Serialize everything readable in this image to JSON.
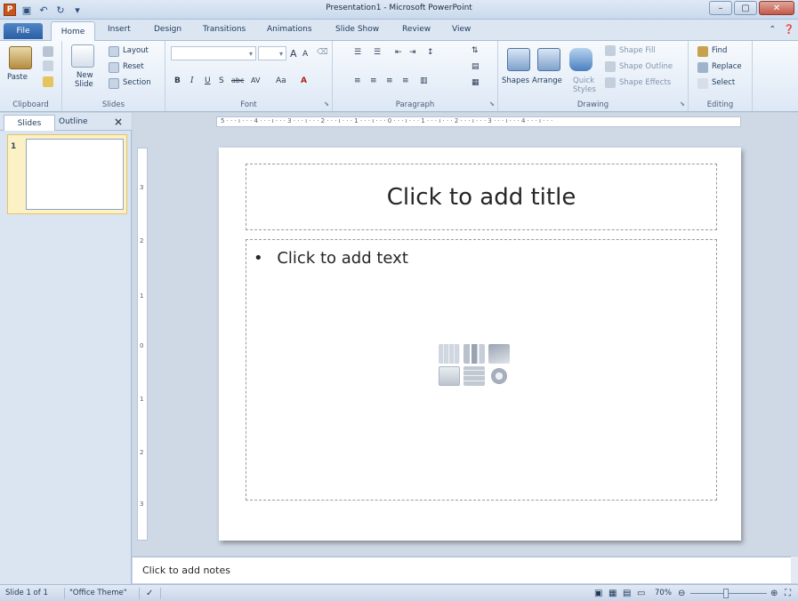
{
  "window": {
    "title": "Presentation1 - Microsoft PowerPoint",
    "app_icon_letter": "P"
  },
  "tabs": {
    "file": "File",
    "home": "Home",
    "insert": "Insert",
    "design": "Design",
    "transitions": "Transitions",
    "animations": "Animations",
    "slideshow": "Slide Show",
    "review": "Review",
    "view": "View"
  },
  "ribbon": {
    "clipboard": {
      "paste": "Paste",
      "label": "Clipboard"
    },
    "slides": {
      "new_slide_1": "New",
      "new_slide_2": "Slide",
      "layout": "Layout",
      "reset": "Reset",
      "section": "Section",
      "label": "Slides"
    },
    "font": {
      "label": "Font",
      "bold": "B",
      "italic": "I",
      "underline": "U",
      "shadow": "S",
      "strike": "abc",
      "spacing": "AV",
      "case": "Aa",
      "grow": "A",
      "shrink": "A"
    },
    "paragraph": {
      "label": "Paragraph"
    },
    "drawing": {
      "shapes": "Shapes",
      "arrange": "Arrange",
      "quick_styles_1": "Quick",
      "quick_styles_2": "Styles",
      "shape_fill": "Shape Fill",
      "shape_outline": "Shape Outline",
      "shape_effects": "Shape Effects",
      "label": "Drawing"
    },
    "editing": {
      "find": "Find",
      "replace": "Replace",
      "select": "Select",
      "label": "Editing"
    }
  },
  "left_pane": {
    "tab_slides": "Slides",
    "tab_outline": "Outline",
    "close": "×",
    "slide_number": "1"
  },
  "slide": {
    "title_placeholder": "Click to add title",
    "body_placeholder": "Click to add text",
    "bullet": "•"
  },
  "rulers": {
    "horizontal": "5 · · · ı · · · 4 · · · ı · · · 3 · · · ı · · · 2 · · · ı · · · 1 · · · ı · · · 0 · · · ı · · · 1 · · · ı · · · 2 · · · ı · · · 3 · · · ı · · · 4 · · · ı · · ·",
    "vertical_ticks": [
      "3",
      "2",
      "1",
      "0",
      "1",
      "2",
      "3"
    ]
  },
  "notes": {
    "placeholder": "Click to add notes"
  },
  "status": {
    "slide_position": "Slide 1 of 1",
    "theme": "\"Office Theme\"",
    "zoom": "70%"
  },
  "colors": {
    "accent": "#2a5ea5",
    "ribbon_bg": "#dde8f5",
    "slide_selected": "#fcf1c5"
  }
}
